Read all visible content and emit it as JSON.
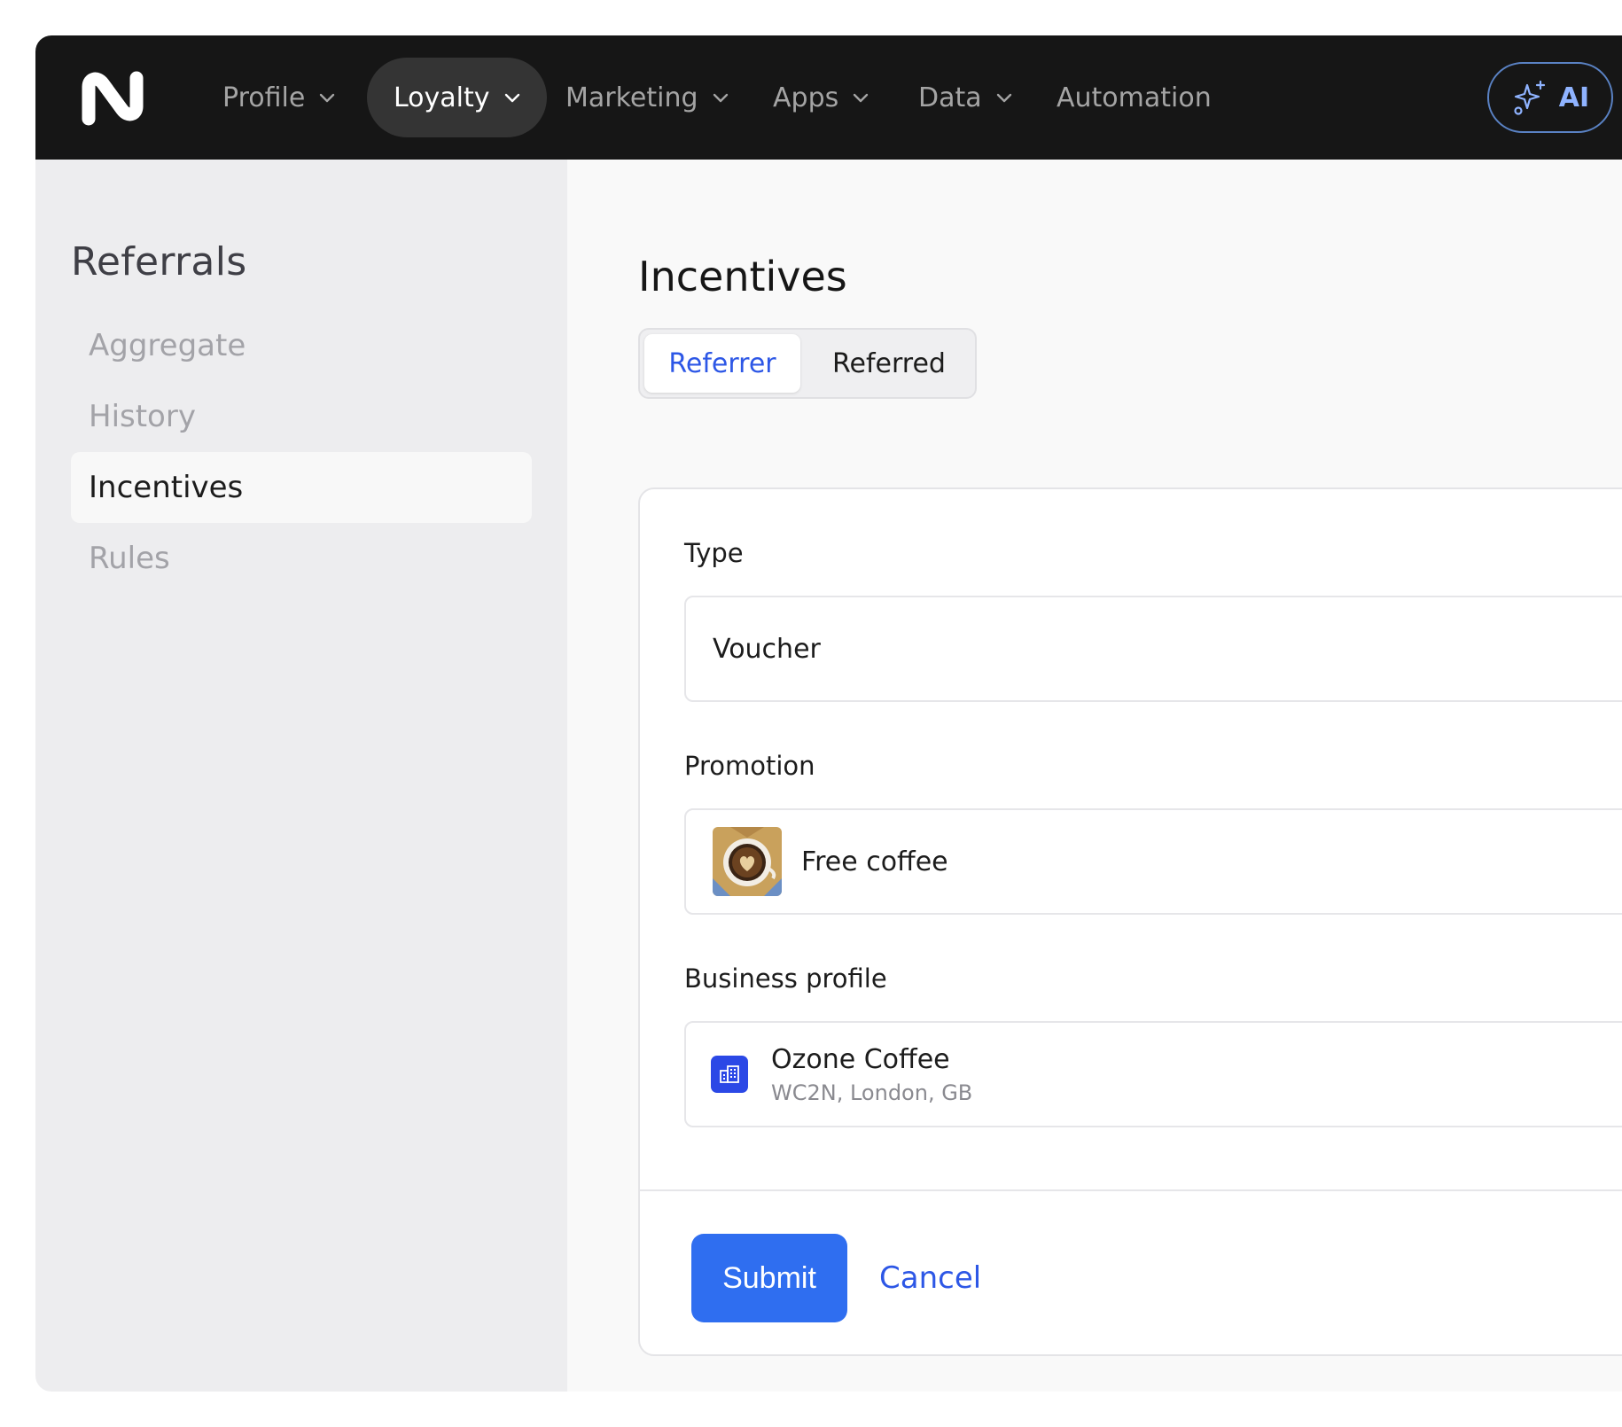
{
  "topbar": {
    "logo_icon": "brand-logo-icon",
    "nav": [
      {
        "label": "Profile",
        "icon": "chevron-down-icon"
      },
      {
        "label": "Loyalty",
        "icon": "chevron-down-icon",
        "active": true
      },
      {
        "label": "Marketing",
        "icon": "chevron-down-icon"
      },
      {
        "label": "Apps",
        "icon": "chevron-down-icon"
      },
      {
        "label": "Data",
        "icon": "chevron-down-icon"
      },
      {
        "label": "Automation"
      }
    ],
    "ai_button": {
      "label": "AI",
      "icon": "sparkles-icon"
    }
  },
  "sidebar": {
    "title": "Referrals",
    "items": [
      {
        "label": "Aggregate"
      },
      {
        "label": "History"
      },
      {
        "label": "Incentives",
        "selected": true
      },
      {
        "label": "Rules"
      }
    ]
  },
  "main": {
    "title": "Incentives",
    "tabs": [
      {
        "label": "Referrer",
        "selected": true
      },
      {
        "label": "Referred"
      }
    ],
    "form": {
      "type": {
        "label": "Type",
        "value": "Voucher"
      },
      "promotion": {
        "label": "Promotion",
        "value": "Free coffee",
        "thumbnail": "coffee-cup-image"
      },
      "business_profile": {
        "label": "Business profile",
        "name": "Ozone Coffee",
        "address": "WC2N, London, GB",
        "icon": "building-icon"
      },
      "submit_label": "Submit",
      "cancel_label": "Cancel"
    }
  },
  "colors": {
    "topbar_bg": "#161616",
    "accent_blue": "#2d57e6",
    "submit_blue": "#2f6ef0",
    "sidebar_bg": "#ededef",
    "ai_outline": "#5a82c4"
  }
}
